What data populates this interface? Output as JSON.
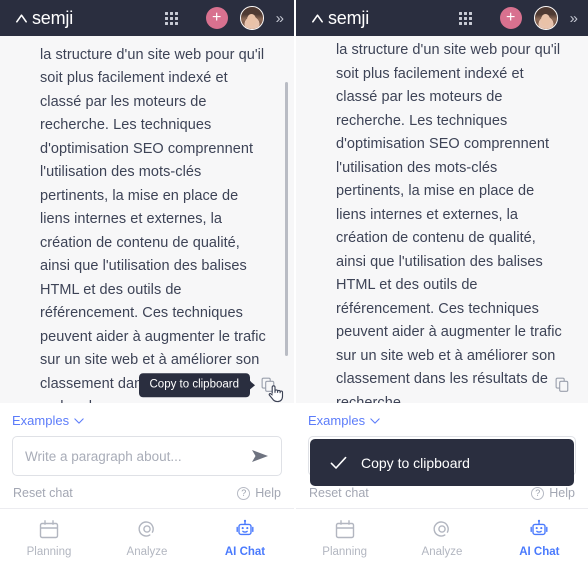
{
  "header": {
    "logo_text": "semji",
    "logo_mark": "caret-up-icon",
    "apps_icon": "grid-dots-icon",
    "add_label": "+",
    "avatar": "user-avatar",
    "expand_icon": "double-chevron-right-icon"
  },
  "left_panel": {
    "message": "la structure d'un site web pour qu'il soit plus facilement indexé et classé par les moteurs de recherche. Les techniques d'optimisation SEO comprennent l'utilisation des mots-clés pertinents, la mise en place de liens internes et externes, la création de contenu de qualité, ainsi que l'utilisation des balises HTML et des outils de référencement. Ces techniques peuvent aider à augmenter le trafic sur un site web et à améliorer son classement dans les résultats de recherche.",
    "tooltip": "Copy to clipboard",
    "copy_icon": "copy-icon",
    "cursor": "pointing-hand-cursor"
  },
  "right_panel": {
    "message": "consiste à optimiser le contenu et la structure d'un site web pour qu'il soit plus facilement indexé et classé par les moteurs de recherche. Les techniques d'optimisation SEO comprennent l'utilisation des mots-clés pertinents, la mise en place de liens internes et externes, la création de contenu de qualité, ainsi que l'utilisation des balises HTML et des outils de référencement. Ces techniques peuvent aider à augmenter le trafic sur un site web et à améliorer son classement dans les résultats de recherche.",
    "copy_icon": "copy-icon",
    "toast": {
      "message": "Copy to clipboard",
      "icon": "check-icon"
    }
  },
  "composer": {
    "examples_label": "Examples",
    "examples_chevron": "chevron-down-icon",
    "input_placeholder": "Write a paragraph about...",
    "input_value": "",
    "send_icon": "send-icon",
    "reset_label": "Reset chat",
    "help_label": "Help",
    "help_icon": "question-mark-icon"
  },
  "tabbar": {
    "items": [
      {
        "label": "Planning",
        "icon": "calendar-icon",
        "active": false
      },
      {
        "label": "Analyze",
        "icon": "target-spiral-icon",
        "active": false
      },
      {
        "label": "AI Chat",
        "icon": "robot-icon",
        "active": true
      }
    ]
  },
  "colors": {
    "appbar_bg": "#2a2e3f",
    "accent_pink": "#d8718f",
    "accent_blue": "#4a7afd",
    "link_blue": "#5c7cfa",
    "chat_bg": "#f7f7f8",
    "text": "#3d4356",
    "muted": "#a3a7b3"
  }
}
